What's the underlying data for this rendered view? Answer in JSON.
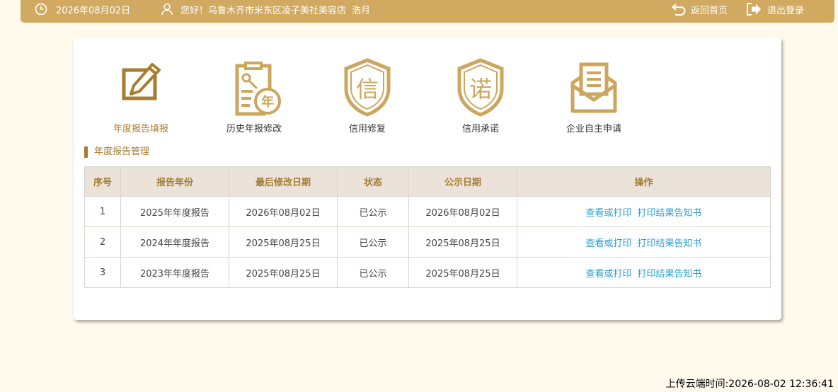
{
  "header": {
    "date": "2026年08月02日",
    "greeting": "您好！乌鲁木齐市米东区凌子美社美容店",
    "user_name": "浩月",
    "home_label": "返回首页",
    "logout_label": "退出登录",
    "bar_color": "#d1a960"
  },
  "icons": {
    "clock": "clock-icon",
    "user": "user-icon",
    "home": "return-icon",
    "logout": "logout-icon"
  },
  "tiles": [
    {
      "label": "年度报告填报",
      "icon": "edit-report-icon",
      "active": true
    },
    {
      "label": "历史年报修改",
      "icon": "history-report-icon",
      "glyph": "年",
      "active": false
    },
    {
      "label": "信用修复",
      "icon": "credit-shield-icon",
      "glyph": "信",
      "active": false
    },
    {
      "label": "信用承诺",
      "icon": "promise-shield-icon",
      "glyph": "诺",
      "active": false
    },
    {
      "label": "企业自主申请",
      "icon": "envelope-icon",
      "active": false
    }
  ],
  "section": {
    "title": "年度报告管理"
  },
  "table": {
    "headers": [
      "序号",
      "报告年份",
      "最后修改日期",
      "状态",
      "公示日期",
      "操作"
    ],
    "rows": [
      {
        "no": "1",
        "year": "2025年年度报告",
        "modified": "2026年08月02日",
        "status": "已公示",
        "published": "2026年08月02日",
        "view": "查看或打印",
        "print": "打印结果告知书"
      },
      {
        "no": "2",
        "year": "2024年年度报告",
        "modified": "2025年08月25日",
        "status": "已公示",
        "published": "2025年08月25日",
        "view": "查看或打印",
        "print": "打印结果告知书"
      },
      {
        "no": "3",
        "year": "2023年年度报告",
        "modified": "2025年08月25日",
        "status": "已公示",
        "published": "2025年08月25日",
        "view": "查看或打印",
        "print": "打印结果告知书"
      }
    ]
  },
  "footer": {
    "upload_time": "上传云端时间:2026-08-02 12:36:41"
  },
  "colors": {
    "accent": "#a77c2e",
    "icon": "#cda65d",
    "link": "#2a9fd0",
    "background": "#fffaeb",
    "header_bg": "#ebe3da"
  }
}
